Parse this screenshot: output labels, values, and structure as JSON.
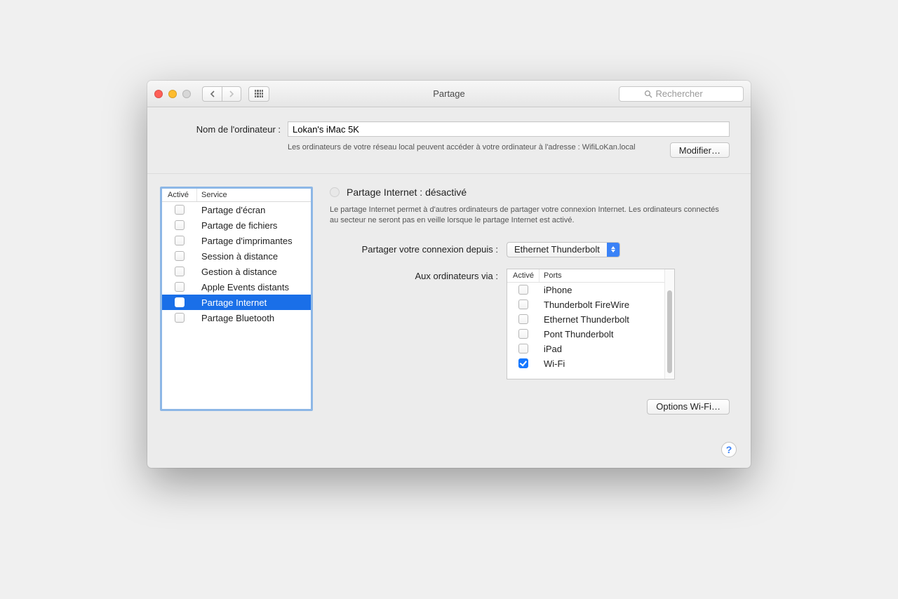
{
  "toolbar": {
    "title": "Partage",
    "search_placeholder": "Rechercher"
  },
  "computer_name": {
    "label": "Nom de l'ordinateur :",
    "value": "Lokan's iMac 5K",
    "description": "Les ordinateurs de votre réseau local peuvent accéder à votre ordinateur à l'adresse : WifiLoKan.local",
    "edit_button": "Modifier…"
  },
  "services": {
    "header_active": "Activé",
    "header_service": "Service",
    "items": [
      {
        "label": "Partage d'écran",
        "checked": false,
        "selected": false
      },
      {
        "label": "Partage de fichiers",
        "checked": false,
        "selected": false
      },
      {
        "label": "Partage d'imprimantes",
        "checked": false,
        "selected": false
      },
      {
        "label": "Session à distance",
        "checked": false,
        "selected": false
      },
      {
        "label": "Gestion à distance",
        "checked": false,
        "selected": false
      },
      {
        "label": "Apple Events distants",
        "checked": false,
        "selected": false
      },
      {
        "label": "Partage Internet",
        "checked": false,
        "selected": true
      },
      {
        "label": "Partage Bluetooth",
        "checked": false,
        "selected": false
      }
    ]
  },
  "detail": {
    "status_title": "Partage Internet : désactivé",
    "description": "Le partage Internet permet à d'autres ordinateurs de partager votre connexion Internet. Les ordinateurs connectés au secteur ne seront pas en veille lorsque le partage Internet est activé.",
    "share_from_label": "Partager votre connexion depuis :",
    "share_from_value": "Ethernet Thunderbolt",
    "to_computers_label": "Aux ordinateurs via :",
    "ports_header_active": "Activé",
    "ports_header_ports": "Ports",
    "ports": [
      {
        "label": "iPhone",
        "checked": false
      },
      {
        "label": "Thunderbolt FireWire",
        "checked": false
      },
      {
        "label": "Ethernet Thunderbolt",
        "checked": false
      },
      {
        "label": "Pont Thunderbolt",
        "checked": false
      },
      {
        "label": "iPad",
        "checked": false
      },
      {
        "label": "Wi-Fi",
        "checked": true
      }
    ],
    "wifi_options_button": "Options Wi-Fi…"
  },
  "footer": {
    "help": "?"
  }
}
